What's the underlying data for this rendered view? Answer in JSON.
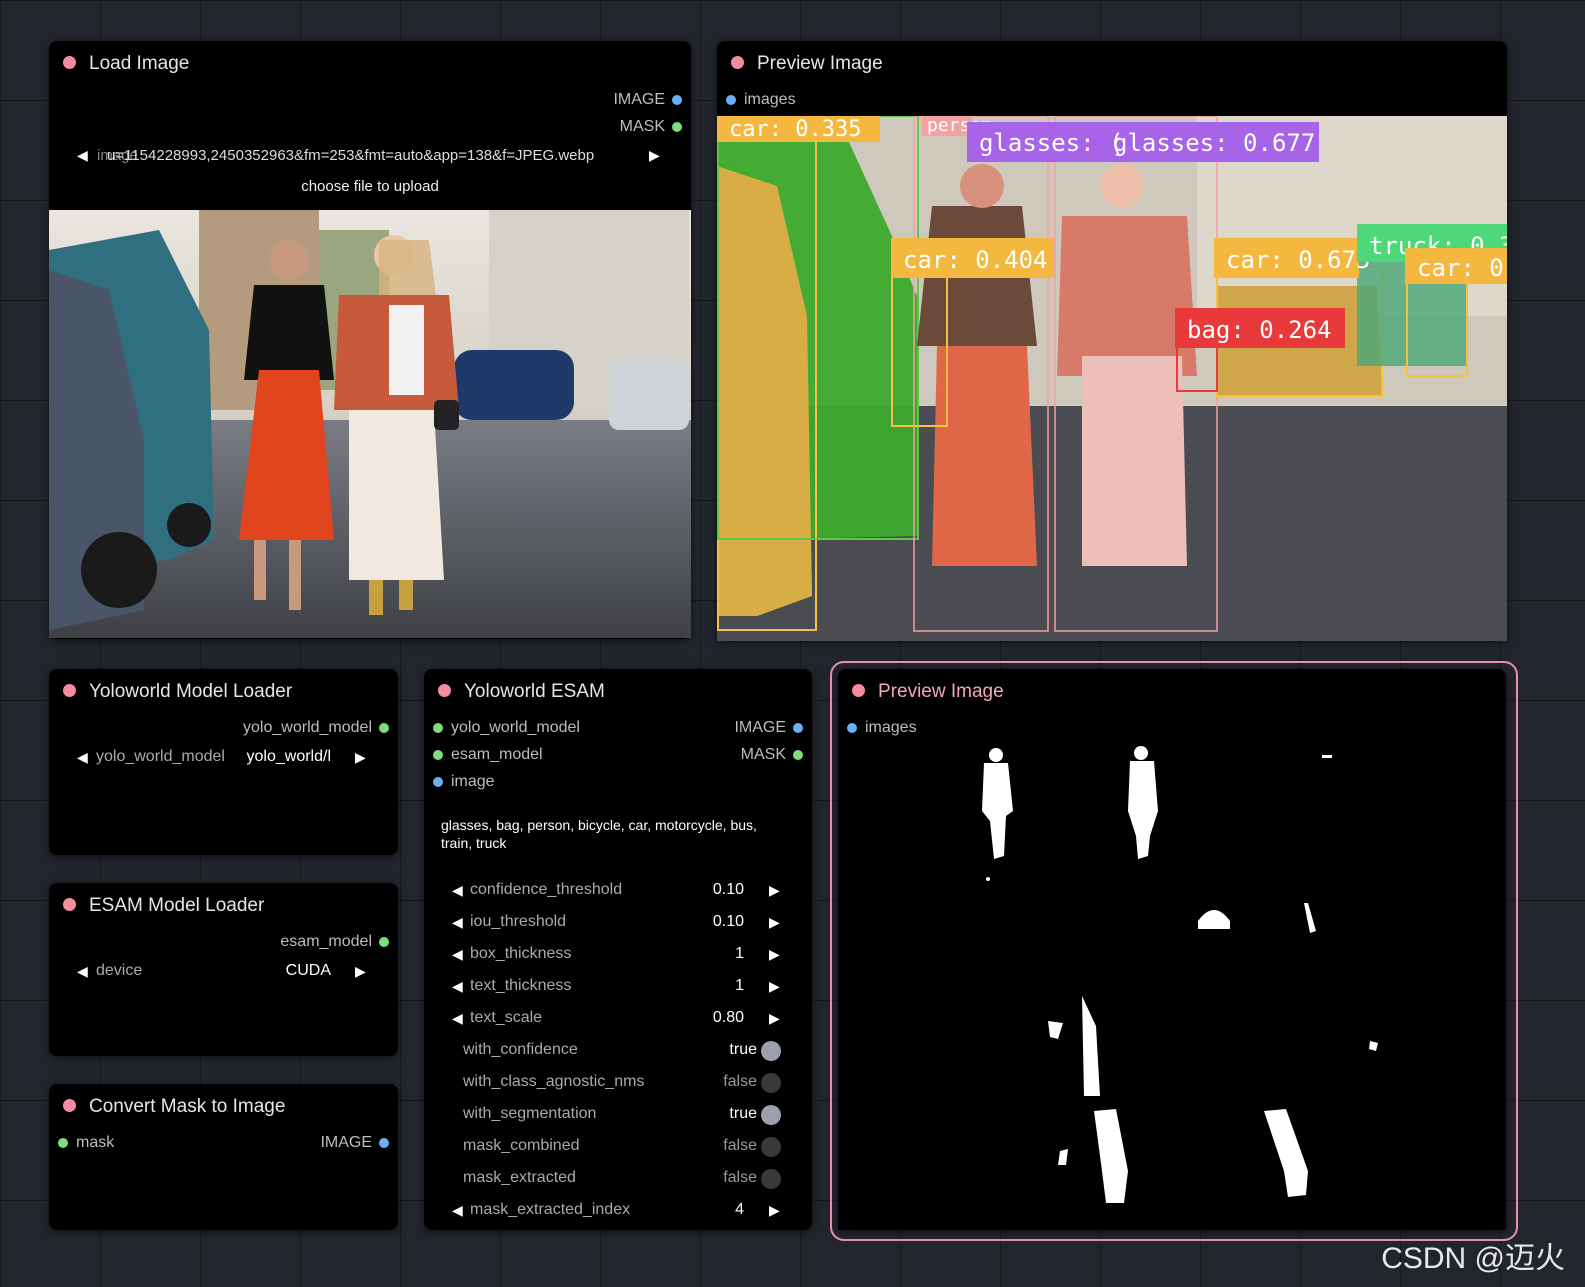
{
  "nodes": {
    "load_image": {
      "title": "Load Image",
      "outputs": [
        "IMAGE",
        "MASK"
      ],
      "file_widget_label": "image",
      "file_value": "u=1154228993,2450352963&fm=253&fmt=auto&app=138&f=JPEG.webp",
      "upload_label": "choose file to upload"
    },
    "preview_image_1": {
      "title": "Preview Image",
      "input": "images",
      "detections": [
        "car: 0.335",
        "person",
        "glasses: (",
        "glasses: 0.677",
        "car: 0.404",
        "car: 0.675",
        "truck: 0.3",
        "car: 0.",
        "bag: 0.264"
      ]
    },
    "yoloworld_loader": {
      "title": "Yoloworld Model Loader",
      "output": "yolo_world_model",
      "widget_label": "yolo_world_model",
      "widget_value": "yolo_world/l"
    },
    "esam_loader": {
      "title": "ESAM Model Loader",
      "output": "esam_model",
      "widget_label": "device",
      "widget_value": "CUDA"
    },
    "convert_mask": {
      "title": "Convert Mask to Image",
      "input": "mask",
      "output": "IMAGE"
    },
    "yoloworld_esam": {
      "title": "Yoloworld ESAM",
      "inputs": [
        "yolo_world_model",
        "esam_model",
        "image"
      ],
      "outputs": [
        "IMAGE",
        "MASK"
      ],
      "categories": "glasses, bag, person,  bicycle, car, motorcycle, bus, train, truck",
      "number_widgets": [
        {
          "label": "confidence_threshold",
          "value": "0.10"
        },
        {
          "label": "iou_threshold",
          "value": "0.10"
        },
        {
          "label": "box_thickness",
          "value": "1"
        },
        {
          "label": "text_thickness",
          "value": "1"
        },
        {
          "label": "text_scale",
          "value": "0.80"
        }
      ],
      "toggle_widgets": [
        {
          "label": "with_confidence",
          "value": "true",
          "on": true
        },
        {
          "label": "with_class_agnostic_nms",
          "value": "false",
          "on": false
        },
        {
          "label": "with_segmentation",
          "value": "true",
          "on": true
        },
        {
          "label": "mask_combined",
          "value": "false",
          "on": false
        },
        {
          "label": "mask_extracted",
          "value": "false",
          "on": false
        }
      ],
      "index_widget": {
        "label": "mask_extracted_index",
        "value": "4"
      }
    },
    "preview_image_2": {
      "title": "Preview Image",
      "input": "images"
    }
  },
  "watermark": "CSDN @迈火",
  "colors": {
    "title_dot": "#f48ca0",
    "slot_green": "#7fdd7f",
    "slot_blue": "#6ab0f3",
    "selected_border": "#e891a8"
  }
}
